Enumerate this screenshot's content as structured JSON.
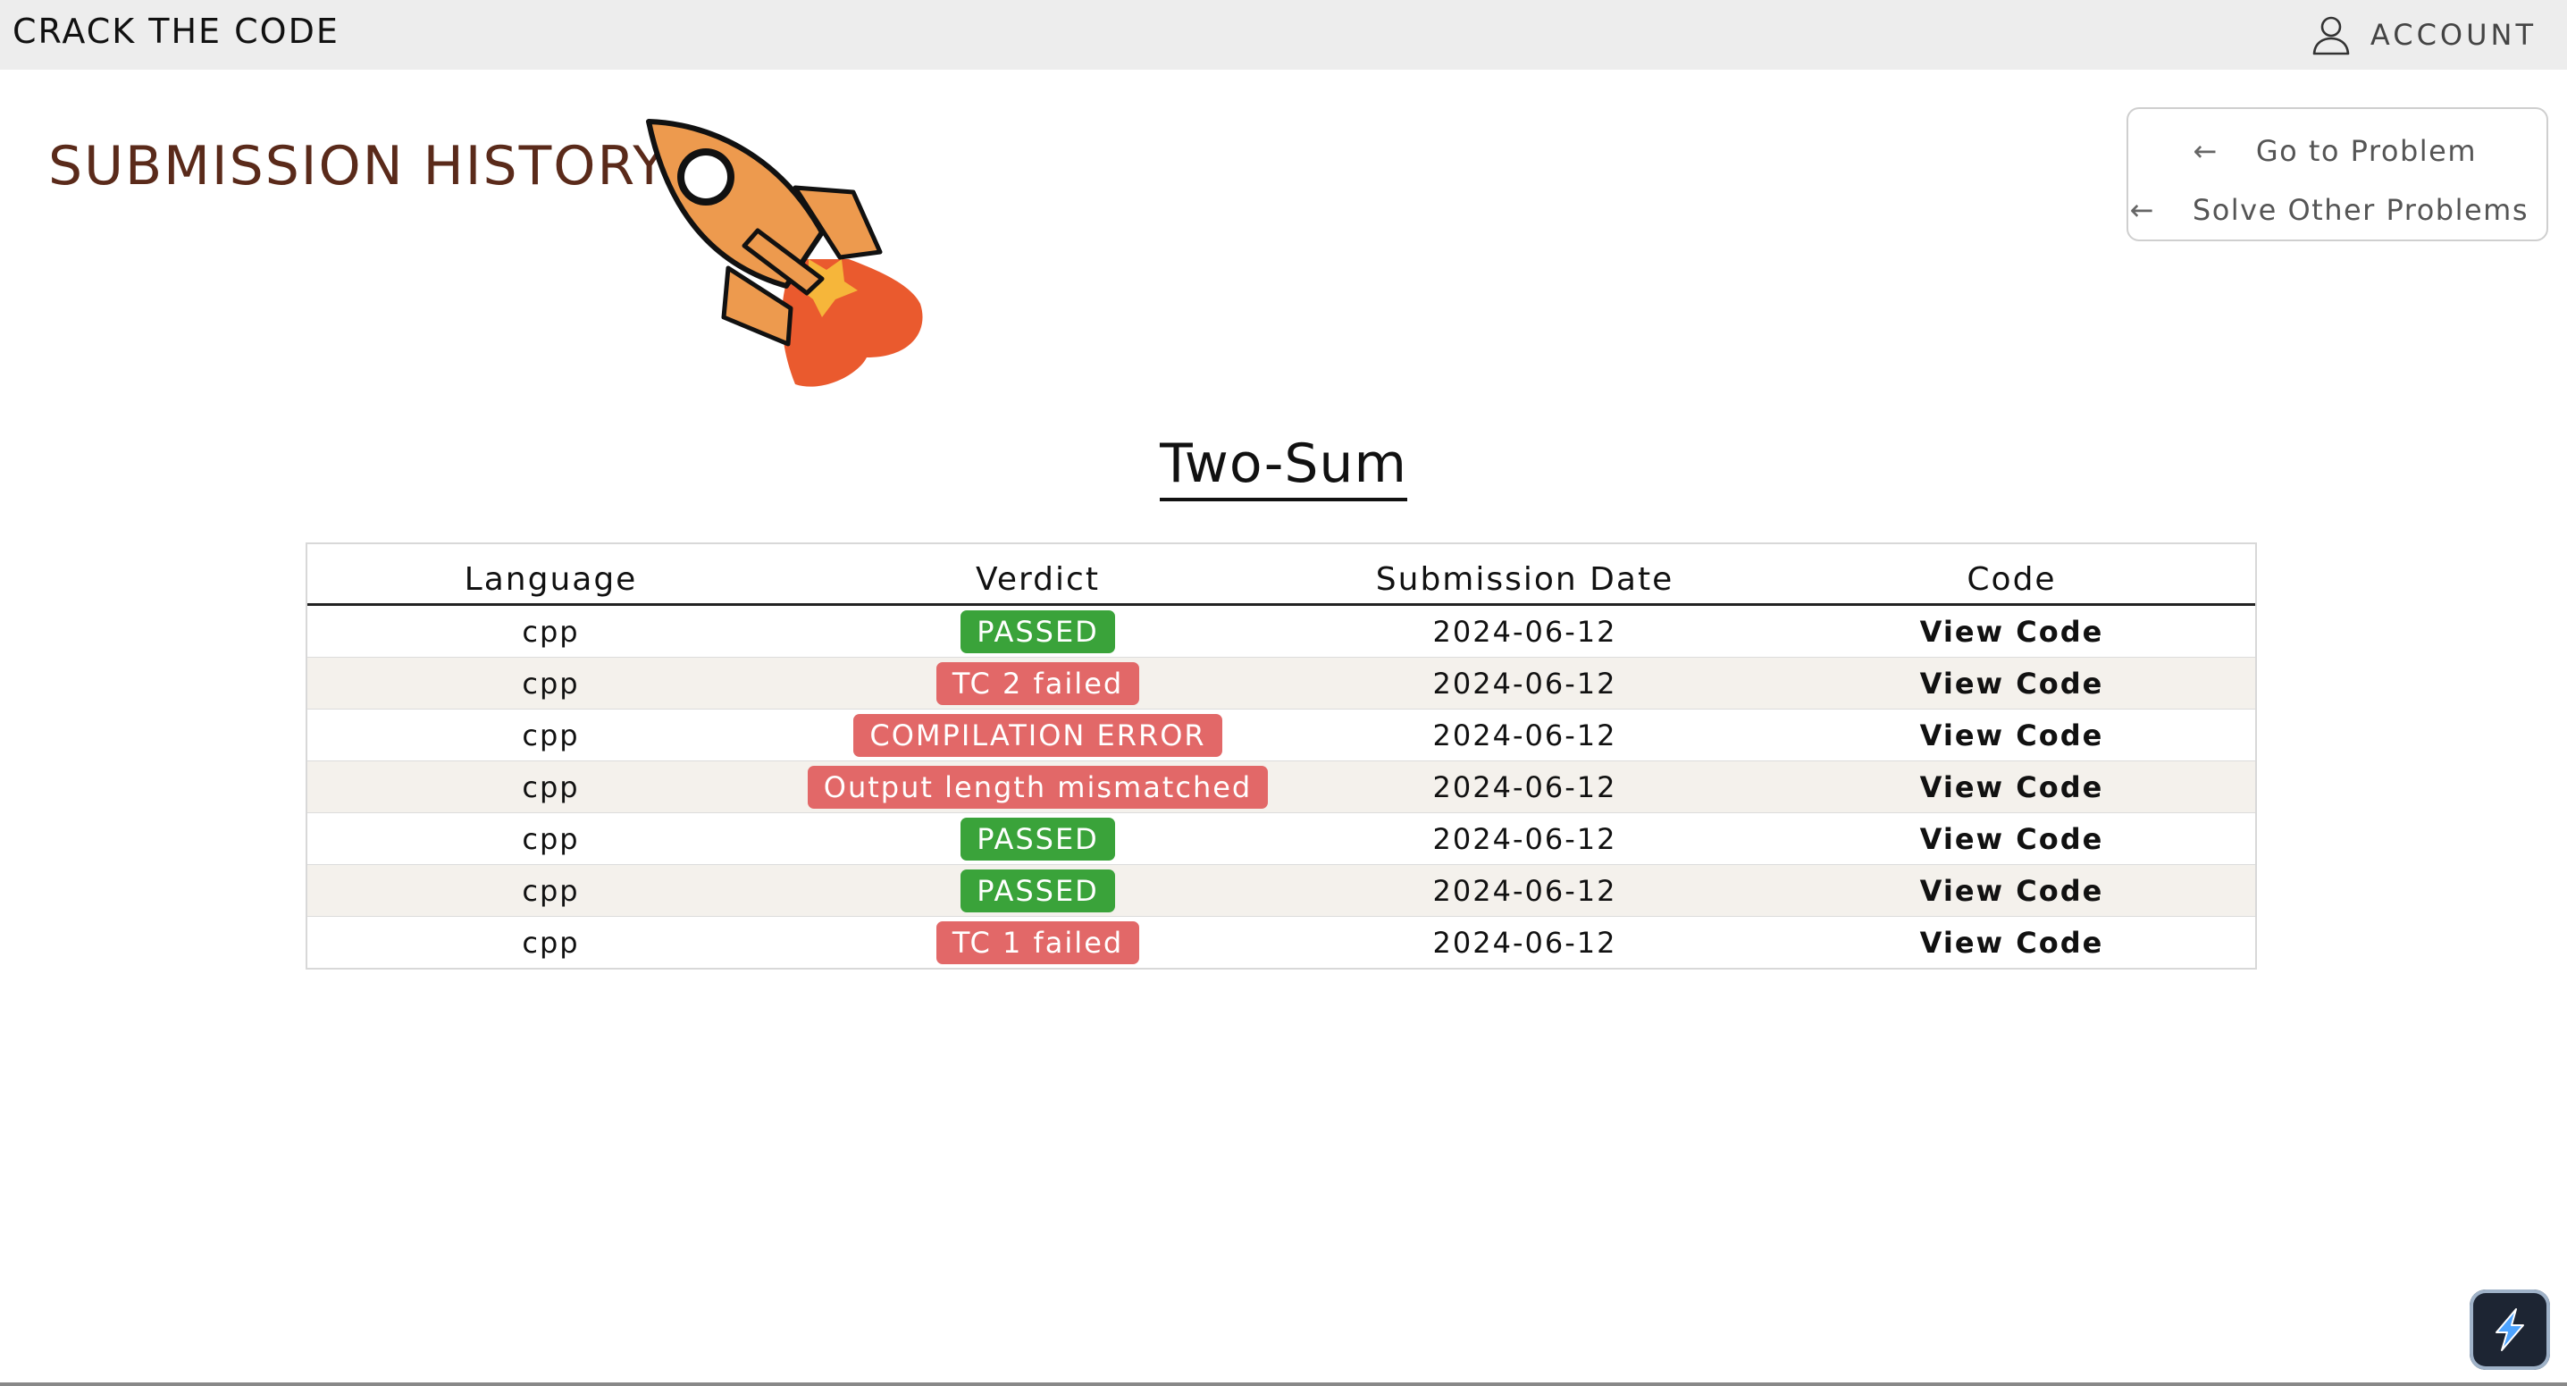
{
  "header": {
    "brand": "CRACK THE CODE",
    "account_label": "ACCOUNT",
    "account_icon": "user-icon"
  },
  "page": {
    "title": "SUBMISSION HISTORY",
    "illustration": "rocket-icon",
    "problem_name": "Two-Sum"
  },
  "nav": {
    "go_to_problem": "Go to Problem",
    "solve_other": "Solve Other Problems",
    "arrow": "←"
  },
  "table": {
    "columns": [
      "Language",
      "Verdict",
      "Submission Date",
      "Code"
    ],
    "rows": [
      {
        "language": "cpp",
        "verdict": "PASSED",
        "status": "pass",
        "date": "2024-06-12",
        "code": "View Code"
      },
      {
        "language": "cpp",
        "verdict": "TC 2 failed",
        "status": "fail",
        "date": "2024-06-12",
        "code": "View Code"
      },
      {
        "language": "cpp",
        "verdict": "COMPILATION ERROR",
        "status": "fail",
        "date": "2024-06-12",
        "code": "View Code"
      },
      {
        "language": "cpp",
        "verdict": "Output length mismatched",
        "status": "fail",
        "date": "2024-06-12",
        "code": "View Code"
      },
      {
        "language": "cpp",
        "verdict": "PASSED",
        "status": "pass",
        "date": "2024-06-12",
        "code": "View Code"
      },
      {
        "language": "cpp",
        "verdict": "PASSED",
        "status": "pass",
        "date": "2024-06-12",
        "code": "View Code"
      },
      {
        "language": "cpp",
        "verdict": "TC 1 failed",
        "status": "fail",
        "date": "2024-06-12",
        "code": "View Code"
      }
    ]
  },
  "colors": {
    "passed": "#3aa33a",
    "failed": "#e26868",
    "title": "#5a2a1a",
    "stripe": "#f4f1ec"
  },
  "corner_app_icon": "app-launcher-icon"
}
